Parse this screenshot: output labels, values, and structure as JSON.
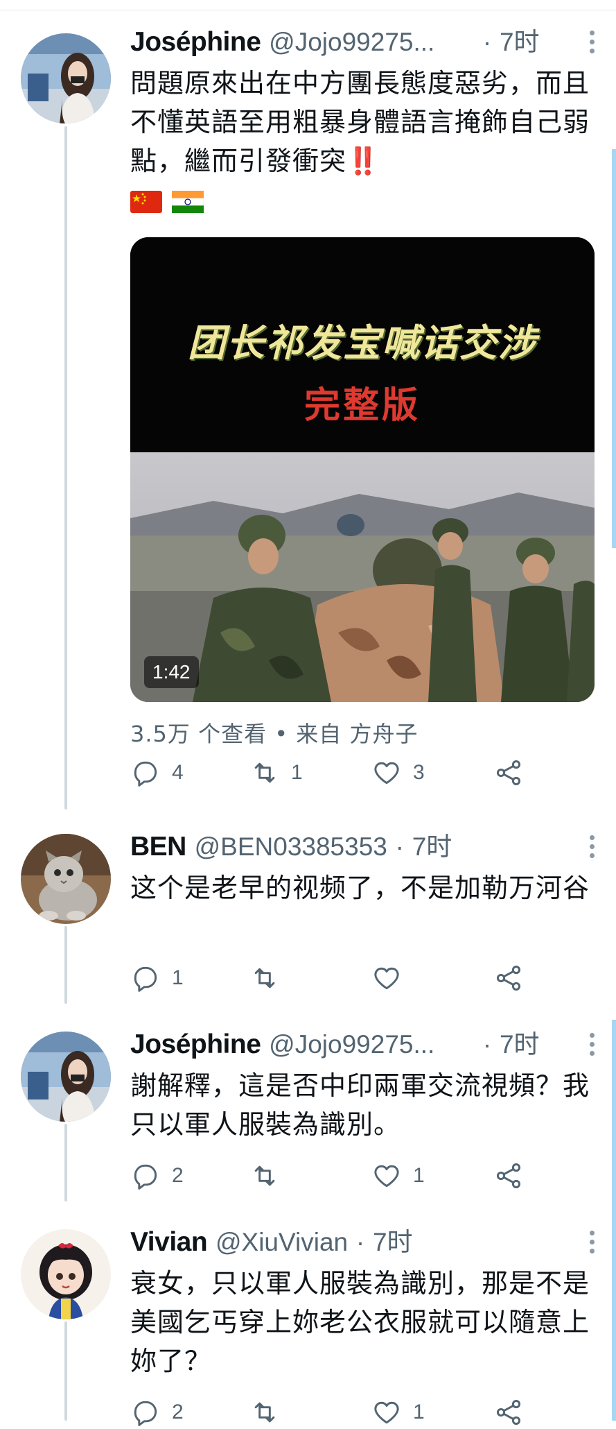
{
  "tweets": [
    {
      "name": "Joséphine",
      "handle": "@Jojo99275...",
      "dot": "·",
      "time": "7时",
      "text": "問題原來出在中方團長態度惡劣，而且不懂英語至用粗暴身體語言掩飾自己弱點，繼而引發衝突‼️",
      "flags": [
        "🇨🇳",
        "🇮🇳"
      ],
      "video": {
        "title": "团长祁发宝喊话交涉",
        "subtitle": "完整版",
        "duration": "1:42"
      },
      "meta": "3.5万 个查看 • 来自 方舟子",
      "replies": "4",
      "retweets": "1",
      "likes": "3"
    },
    {
      "name": "BEN",
      "handle": "@BEN03385353",
      "dot": "·",
      "time": "7时",
      "text": "这个是老早的视频了，不是加勒万河谷",
      "replies": "1",
      "retweets": "",
      "likes": ""
    },
    {
      "name": "Joséphine",
      "handle": "@Jojo99275...",
      "dot": "·",
      "time": "7时",
      "text": "謝解釋，這是否中印兩軍交流視頻？我只以軍人服裝為識別。",
      "replies": "2",
      "retweets": "",
      "likes": "1"
    },
    {
      "name": "Vivian",
      "handle": "@XiuVivian",
      "dot": "·",
      "time": "7时",
      "text": "衰女，只以軍人服裝為識別，那是不是美國乞丐穿上妳老公衣服就可以隨意上妳了？",
      "replies": "2",
      "retweets": "",
      "likes": "1"
    }
  ],
  "icons": {
    "reply": "reply-icon",
    "retweet": "retweet-icon",
    "like": "like-icon",
    "share": "share-icon",
    "more": "more-icon"
  },
  "colors": {
    "name": "#0f1419",
    "secondary": "#536471",
    "rail": "#cfd9de",
    "accent_bar": "#a8d5f2",
    "video_title": "#f0e79a",
    "video_subtitle": "#e0392f"
  }
}
